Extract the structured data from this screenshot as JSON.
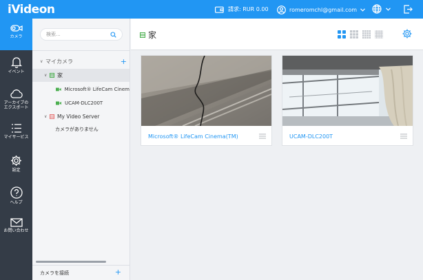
{
  "app": {
    "logo": "iVideon"
  },
  "topbar": {
    "billing": "請求: RUR 0.00",
    "user_email": "romeromchl@gmail.com"
  },
  "nav": {
    "items": [
      {
        "label": "カメラ",
        "icon": "camera-icon",
        "active": true
      },
      {
        "label": "イベント",
        "icon": "bell-icon"
      },
      {
        "label": "アーカイブのエクスポート",
        "icon": "cloud-icon"
      },
      {
        "label": "マイサービス",
        "icon": "list-icon"
      },
      {
        "label": "設定",
        "icon": "gear-icon"
      },
      {
        "label": "ヘルプ",
        "icon": "help-icon"
      },
      {
        "label": "お問い合わせ",
        "icon": "mail-icon"
      }
    ]
  },
  "tree": {
    "search_placeholder": "検索...",
    "root_label": "マイカメラ",
    "group_label": "家",
    "cameras": [
      "Microsoft® LifeCam Cinema",
      "UCAM-DLC200T"
    ],
    "server_label": "My Video Server",
    "server_empty": "カメラがありません",
    "footer_label": "カメラを接続"
  },
  "main": {
    "title": "家",
    "cards": [
      {
        "caption": "Microsoft® LifeCam Cinema(TM)"
      },
      {
        "caption": "UCAM-DLC200T"
      }
    ]
  },
  "colors": {
    "brand": "#2196f3",
    "nav_bg": "#343c47",
    "folder_green": "#4caf50",
    "server_red": "#e57373"
  }
}
